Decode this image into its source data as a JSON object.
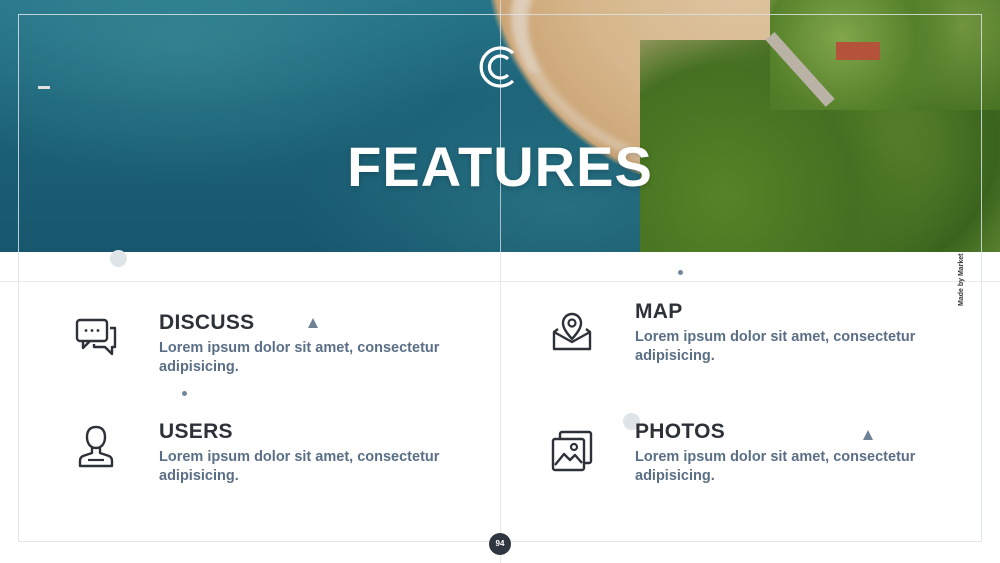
{
  "slide": {
    "title": "FEATURES",
    "credit": "Made by Market",
    "page_number": "94"
  },
  "features": [
    {
      "heading": "DISCUSS",
      "body": "Lorem ipsum dolor sit amet, consectetur adipisicing.",
      "icon": "chat-bubbles-icon"
    },
    {
      "heading": "MAP",
      "body": "Lorem ipsum dolor sit amet, consectetur adipisicing.",
      "icon": "map-pin-envelope-icon"
    },
    {
      "heading": "USERS",
      "body": "Lorem ipsum dolor sit amet, consectetur adipisicing.",
      "icon": "user-icon"
    },
    {
      "heading": "PHOTOS",
      "body": "Lorem ipsum dolor sit amet, consectetur adipisicing.",
      "icon": "photos-icon"
    }
  ],
  "colors": {
    "heading": "#2d3138",
    "body_text": "#5a6f86",
    "accent_shape": "#6f8293",
    "page_badge": "#2f3640"
  }
}
